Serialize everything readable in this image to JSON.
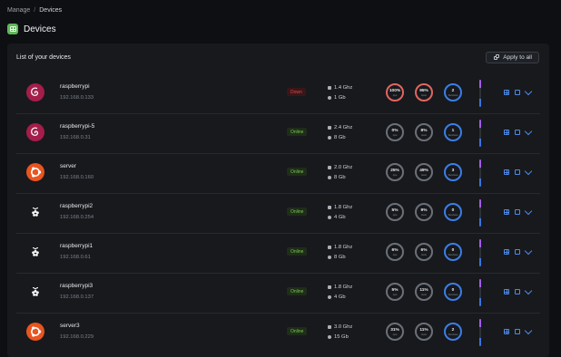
{
  "breadcrumb": {
    "parent": "Manage",
    "separator": "/",
    "current": "Devices"
  },
  "page": {
    "title": "Devices"
  },
  "panel": {
    "heading": "List of your devices",
    "apply_label": "Apply to all"
  },
  "devices": [
    {
      "name": "raspberrypi",
      "ip": "192.168.0.133",
      "os": "debian",
      "status": "Down",
      "state": "down",
      "cpu": "1.4 Ghz",
      "mem": "1 Gb",
      "cpu_use": "100%",
      "cpu_use_label": "cpu",
      "mem_use": "95%",
      "mem_use_label": "mem",
      "services": "2",
      "services_label": "Services"
    },
    {
      "name": "raspberrypi-5",
      "ip": "192.168.0.31",
      "os": "debian",
      "status": "Online",
      "state": "online",
      "cpu": "2.4 Ghz",
      "mem": "8 Gb",
      "cpu_use": "0%",
      "cpu_use_label": "cpu",
      "mem_use": "8%",
      "mem_use_label": "mem",
      "services": "1",
      "services_label": "Services"
    },
    {
      "name": "server",
      "ip": "192.168.0.160",
      "os": "ubuntu",
      "status": "Online",
      "state": "online",
      "cpu": "2.0 Ghz",
      "mem": "8 Gb",
      "cpu_use": "25%",
      "cpu_use_label": "cpu",
      "mem_use": "49%",
      "mem_use_label": "mem",
      "services": "3",
      "services_label": "Services"
    },
    {
      "name": "raspberrypi2",
      "ip": "192.168.0.254",
      "os": "raspberry",
      "status": "Online",
      "state": "online",
      "cpu": "1.8 Ghz",
      "mem": "4 Gb",
      "cpu_use": "5%",
      "cpu_use_label": "cpu",
      "mem_use": "9%",
      "mem_use_label": "mem",
      "services": "0",
      "services_label": "Services"
    },
    {
      "name": "raspberrypi1",
      "ip": "192.168.0.61",
      "os": "raspberry",
      "status": "Online",
      "state": "online",
      "cpu": "1.8 Ghz",
      "mem": "8 Gb",
      "cpu_use": "6%",
      "cpu_use_label": "cpu",
      "mem_use": "6%",
      "mem_use_label": "mem",
      "services": "0",
      "services_label": "Services"
    },
    {
      "name": "raspberrypi3",
      "ip": "192.168.0.137",
      "os": "raspberry",
      "status": "Online",
      "state": "online",
      "cpu": "1.8 Ghz",
      "mem": "4 Gb",
      "cpu_use": "5%",
      "cpu_use_label": "cpu",
      "mem_use": "11%",
      "mem_use_label": "mem",
      "services": "0",
      "services_label": "Services"
    },
    {
      "name": "server3",
      "ip": "192.168.0.229",
      "os": "ubuntu",
      "status": "Online",
      "state": "online",
      "cpu": "3.0 Ghz",
      "mem": "15 Gb",
      "cpu_use": "31%",
      "cpu_use_label": "cpu",
      "mem_use": "11%",
      "mem_use_label": "mem",
      "services": "2",
      "services_label": "Services"
    }
  ],
  "colors": {
    "online": "#7bc64d",
    "down": "#e0474d",
    "accent_blue": "#3d7ee6",
    "alert_red": "#e2655f",
    "purple": "#a45ee9"
  }
}
